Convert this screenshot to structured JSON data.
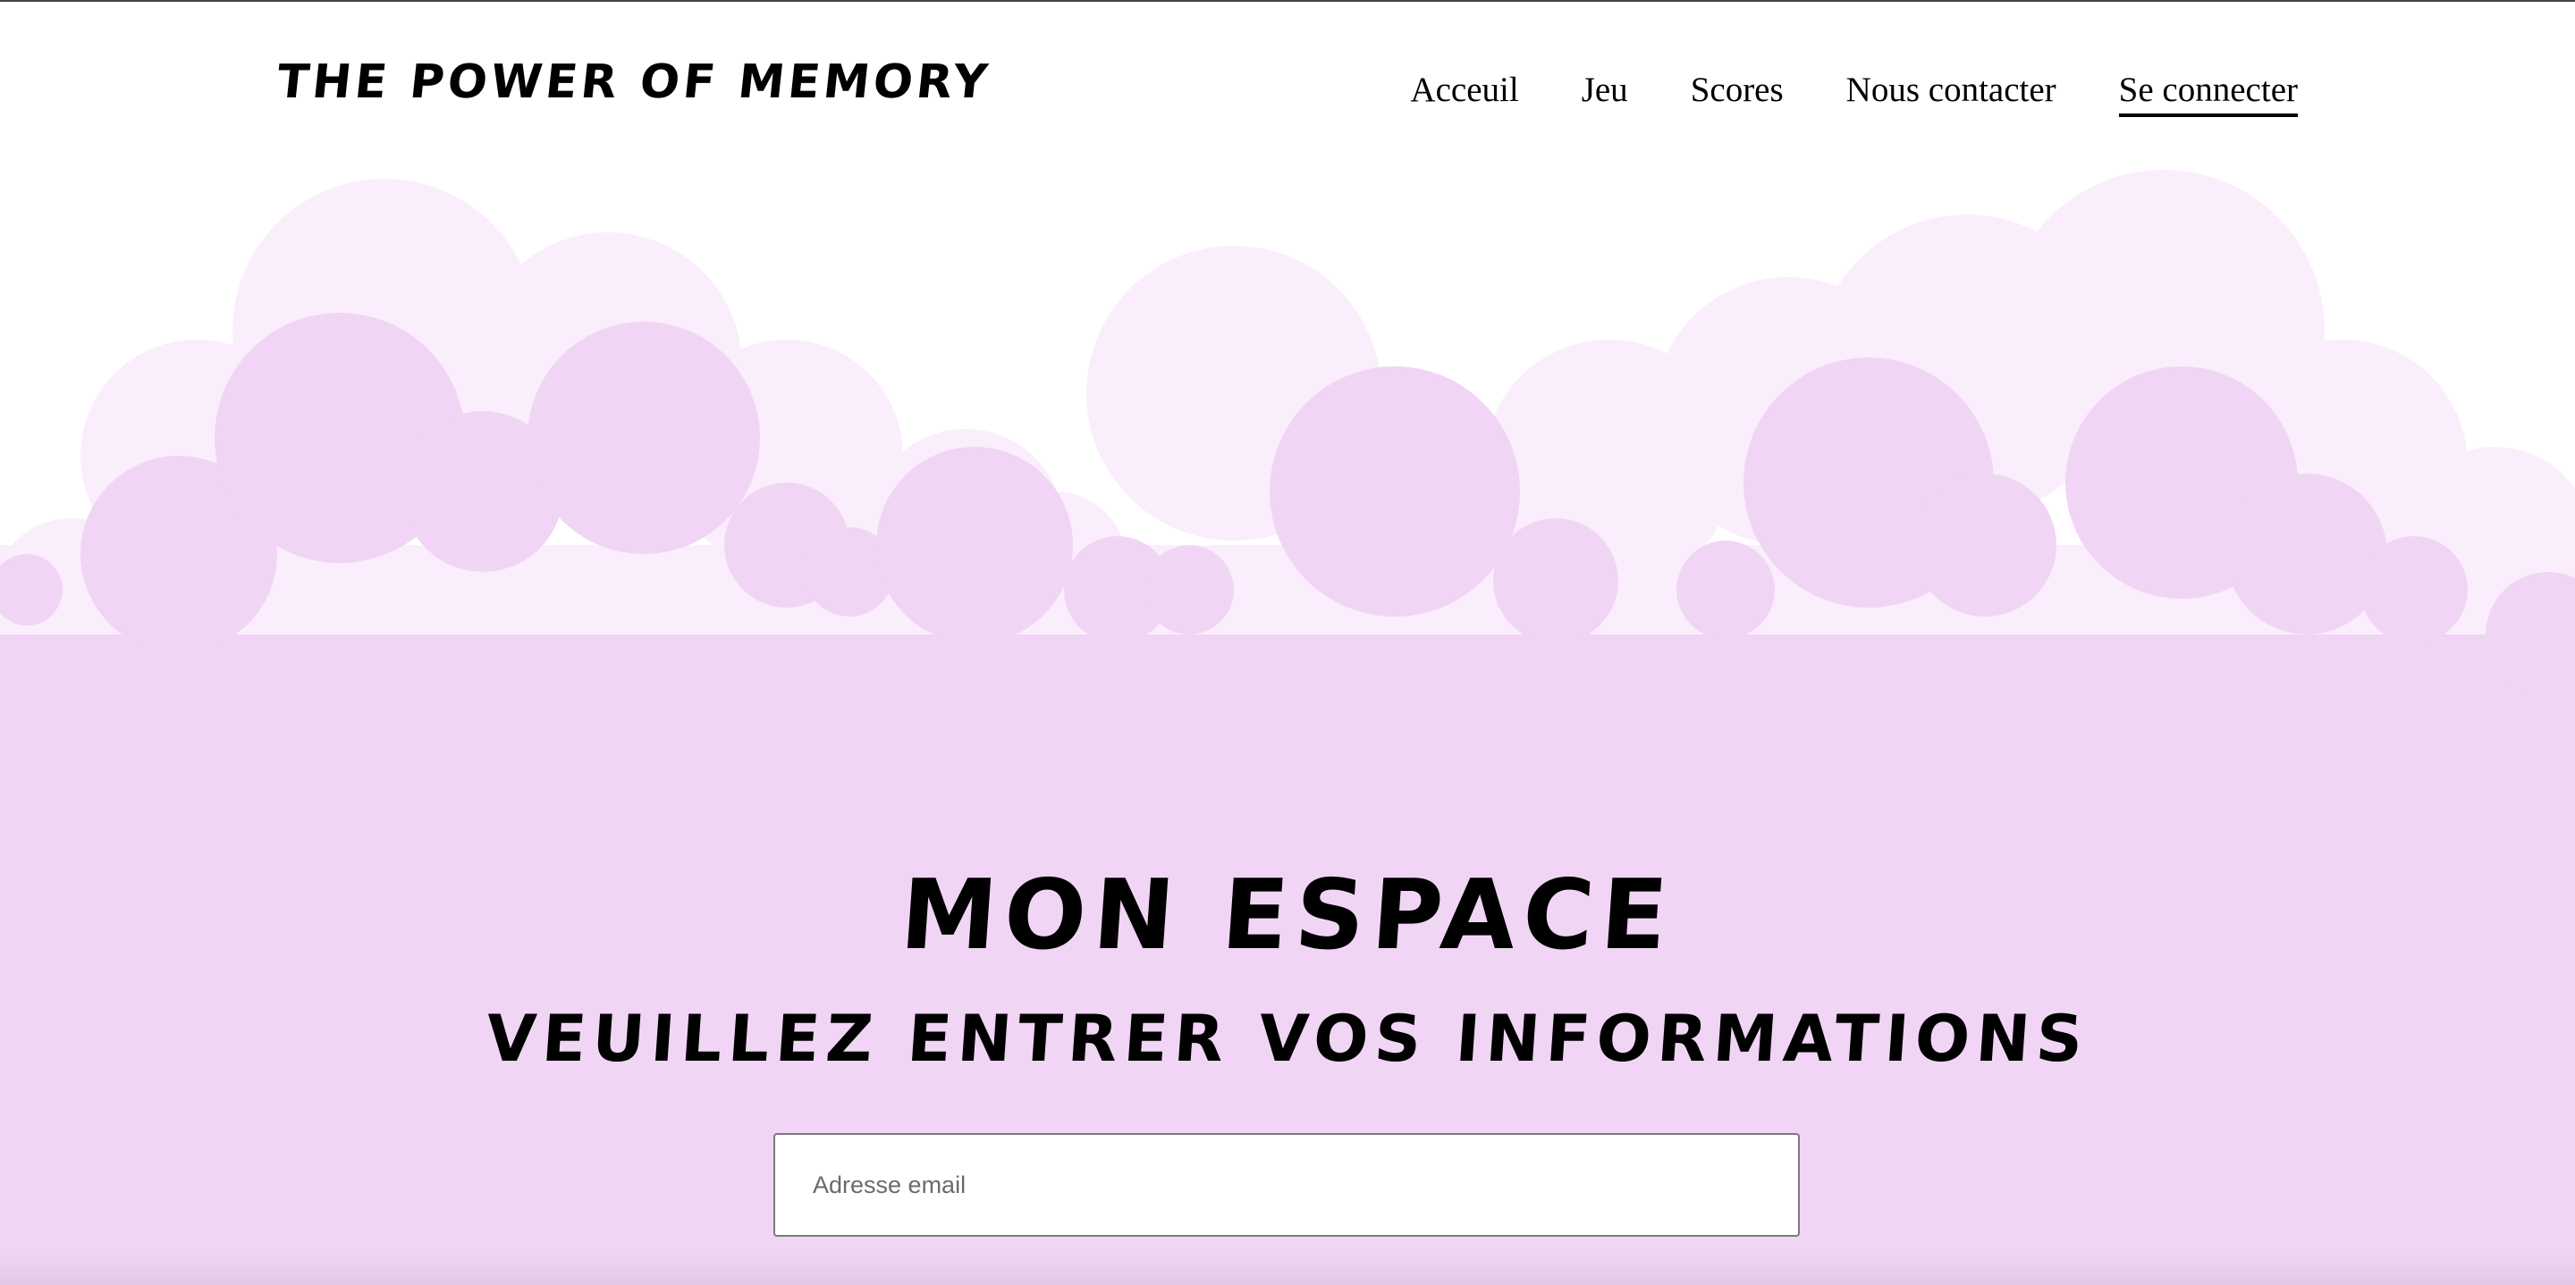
{
  "header": {
    "logo": "The Power of Memory",
    "nav": [
      {
        "label": "Acceuil"
      },
      {
        "label": "Jeu"
      },
      {
        "label": "Scores"
      },
      {
        "label": "Nous contacter"
      },
      {
        "label": "Se connecter",
        "active": true
      }
    ]
  },
  "hero": {
    "title": "Mon espace",
    "subtitle": "Veuillez entrer vos informations"
  },
  "form": {
    "email_placeholder": "Adresse email",
    "email_value": ""
  },
  "colors": {
    "cloud_light": "#fbeefc",
    "cloud_main": "#f1d5f5",
    "text": "#000000"
  }
}
